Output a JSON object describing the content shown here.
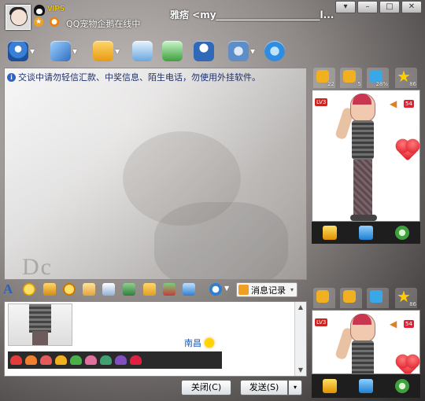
{
  "window": {
    "title": "雅痞 <my______________________l...",
    "controls": [
      "▾",
      "–",
      "□",
      "✕"
    ]
  },
  "profile": {
    "vip_label": "VIP5",
    "status_text": "QQ宠物企鹅在线中"
  },
  "toolbar": {
    "items": [
      {
        "name": "video-call",
        "icon": "webcam-icon",
        "color": "#3a7fd6"
      },
      {
        "name": "voice-chat",
        "icon": "microphone-icon",
        "color": "#5aa0e8"
      },
      {
        "name": "send-file",
        "icon": "folder-arrow-icon",
        "color": "#f4b21e"
      },
      {
        "name": "send-email",
        "icon": "mail-icon",
        "color": "#6aa7de"
      },
      {
        "name": "add-group",
        "icon": "add-contact-icon",
        "color": "#4bb04b"
      },
      {
        "name": "qq-show",
        "icon": "penguin-icon",
        "color": "#3069b8"
      },
      {
        "name": "settings",
        "icon": "gear-icon",
        "color": "#5e8ec8"
      },
      {
        "name": "internet",
        "icon": "ie-icon",
        "color": "#2f8de0"
      }
    ]
  },
  "messages": {
    "notice": "交谈中请勿轻信汇款、中奖信息、陌生电话，勿使用外挂软件。",
    "watermark": "Dc"
  },
  "format_bar": {
    "font_label": "A",
    "history_label": "消息记录",
    "history_arrow": "▾"
  },
  "input": {
    "recv_nick": "南昌",
    "gems": [
      "#e53b3b",
      "#f08030",
      "#e55a5a",
      "#f0b020",
      "#4ab04a",
      "#e070a0",
      "#40a070",
      "#8050c0",
      "#e02040"
    ]
  },
  "buttons": {
    "close": "关闭(C)",
    "send": "发送(S)",
    "send_dropdown": "▾"
  },
  "right_panel": {
    "tabs": [
      {
        "label": "22",
        "icon": "thumbs-up-icon",
        "color": "#f0b020"
      },
      {
        "label": "5",
        "icon": "thumbs-down-icon",
        "color": "#f0b020"
      },
      {
        "label": "28%",
        "icon": "gift-icon",
        "color": "#3aa7e8"
      },
      {
        "label": "86",
        "icon": "star-icon",
        "color": "#ffcc00"
      }
    ],
    "level": "LV3",
    "volume": "54"
  },
  "right_panel2": {
    "tabs": [
      {
        "label": "",
        "icon": "thumbs-up-icon",
        "color": "#f0b020"
      },
      {
        "label": "",
        "icon": "thumbs-down-icon",
        "color": "#f0b020"
      },
      {
        "label": "",
        "icon": "gift-icon",
        "color": "#3aa7e8"
      },
      {
        "label": "86",
        "icon": "star-icon",
        "color": "#ffcc00"
      }
    ],
    "level": "LV3",
    "volume": "54"
  }
}
